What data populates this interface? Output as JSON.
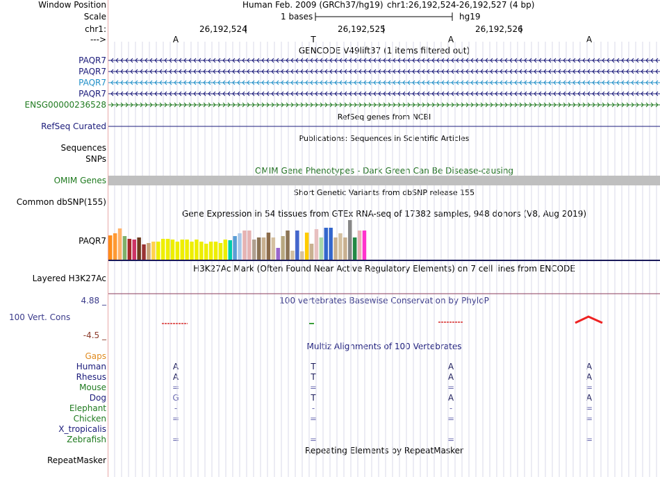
{
  "header": {
    "window_position_label": "Window Position",
    "scale_label": "Scale",
    "chr_label": "chr1:",
    "strand_label": "--->",
    "assembly": "Human Feb. 2009 (GRCh37/hg19)",
    "coords": "chr1:26,192,524-26,192,527 (4 bp)",
    "scale_text": "1 bases",
    "db": "hg19",
    "ruler_ticks": [
      "26,192,524",
      "26,192,525",
      "26,192,526"
    ],
    "bases": [
      "A",
      "T",
      "A",
      "A"
    ]
  },
  "tracks": {
    "gencode": {
      "title": "GENCODE V49lift37 (1 items filtered out)",
      "items": [
        {
          "label": "PAQR7",
          "color": "#1a1a7a",
          "dir": "<"
        },
        {
          "label": "PAQR7",
          "color": "#1a1a7a",
          "dir": "<"
        },
        {
          "label": "PAQR7",
          "color": "#1f8fc8",
          "dir": "<"
        },
        {
          "label": "PAQR7",
          "color": "#1a1a7a",
          "dir": "<"
        },
        {
          "label": "ENSG00000236528",
          "color": "#1f7a1f",
          "dir": ">"
        }
      ]
    },
    "refseq": {
      "title": "RefSeq genes from NCBI",
      "label": "RefSeq Curated",
      "color": "#1a1a7a"
    },
    "publications": {
      "title": "Publications: Sequences in Scientific Articles",
      "labels": [
        "Sequences",
        "SNPs"
      ]
    },
    "omim": {
      "title": "OMIM Gene Phenotypes - Dark Green Can Be Disease-causing",
      "label": "OMIM Genes",
      "color": "#1f6f1f"
    },
    "dbsnp": {
      "title": "Short Genetic Variants from dbSNP release 155",
      "label": "Common dbSNP(155)"
    },
    "gtex": {
      "title": "Gene Expression in 54 tissues from GTEx RNA-seq of 17382 samples, 948 donors (V8, Aug 2019)",
      "label": "PAQR7"
    },
    "h3k27ac": {
      "title": "H3K27Ac Mark (Often Found Near Active Regulatory Elements) on 7 cell lines from ENCODE",
      "label": "Layered H3K27Ac"
    },
    "phylop": {
      "title": "100 vertebrates Basewise Conservation by PhyloP",
      "label": "100 Vert. Cons",
      "max": "4.88 _",
      "min": "-4.5 _"
    },
    "multiz": {
      "title": "Multiz Alignments of 100 Vertebrates",
      "rows": [
        {
          "label": "Gaps",
          "color": "#e08a1e",
          "bases": [
            "",
            "",
            "",
            ""
          ]
        },
        {
          "label": "Human",
          "color": "#1a1a7a",
          "bases": [
            "A",
            "T",
            "A",
            "A"
          ]
        },
        {
          "label": "Rhesus",
          "color": "#1a1a7a",
          "bases": [
            "A",
            "T",
            "A",
            "A"
          ]
        },
        {
          "label": "Mouse",
          "color": "#1f7a1f",
          "bases": [
            "=",
            "=",
            "=",
            "="
          ]
        },
        {
          "label": "Dog",
          "color": "#1a1a7a",
          "bases": [
            "G",
            "T",
            "A",
            "A"
          ]
        },
        {
          "label": "Elephant",
          "color": "#1f7a1f",
          "bases": [
            "-",
            "-",
            "-",
            "="
          ]
        },
        {
          "label": "Chicken",
          "color": "#1f7a1f",
          "bases": [
            "=",
            "=",
            "=",
            "="
          ]
        },
        {
          "label": "X_tropicalis",
          "color": "#1a1a7a",
          "bases": [
            "",
            "",
            "",
            ""
          ]
        },
        {
          "label": "Zebrafish",
          "color": "#1f7a1f",
          "bases": [
            "=",
            "=",
            "=",
            "="
          ]
        }
      ]
    },
    "repeatmasker": {
      "title": "Repeating Elements by RepeatMasker",
      "label": "RepeatMasker"
    }
  },
  "colors": {
    "gtex": [
      "#ff8c1a",
      "#ff9933",
      "#ffb36b",
      "#7fb069",
      "#a52a2a",
      "#cc3366",
      "#6b3a1e",
      "#993333",
      "#c8a57a",
      "#ffd24d",
      "#eeee00",
      "#eeee00",
      "#eeee00",
      "#eeee00",
      "#eeee00",
      "#eeee00",
      "#eeee00",
      "#eeee00",
      "#eeee00",
      "#eeee00",
      "#eeee00",
      "#eeee00",
      "#eeee00",
      "#eeee00",
      "#eeee00",
      "#00ccaa",
      "#5a9ed6",
      "#a9c7e8",
      "#e6b3b3",
      "#e6b3b3",
      "#b0a090",
      "#8b7355",
      "#c8b090",
      "#8b6b4a",
      "#d4c0a0",
      "#9966cc",
      "#b8a880",
      "#8b7355",
      "#d4c0a0",
      "#4466cc",
      "#d4c0a0",
      "#ffcc00",
      "#c8b090",
      "#e8c0c0",
      "#a8d8a8",
      "#3366cc",
      "#3366cc",
      "#c8b090",
      "#d4c0a0",
      "#c8b090",
      "#888888",
      "#228844",
      "#e6b3b3",
      "#ff33cc"
    ]
  }
}
